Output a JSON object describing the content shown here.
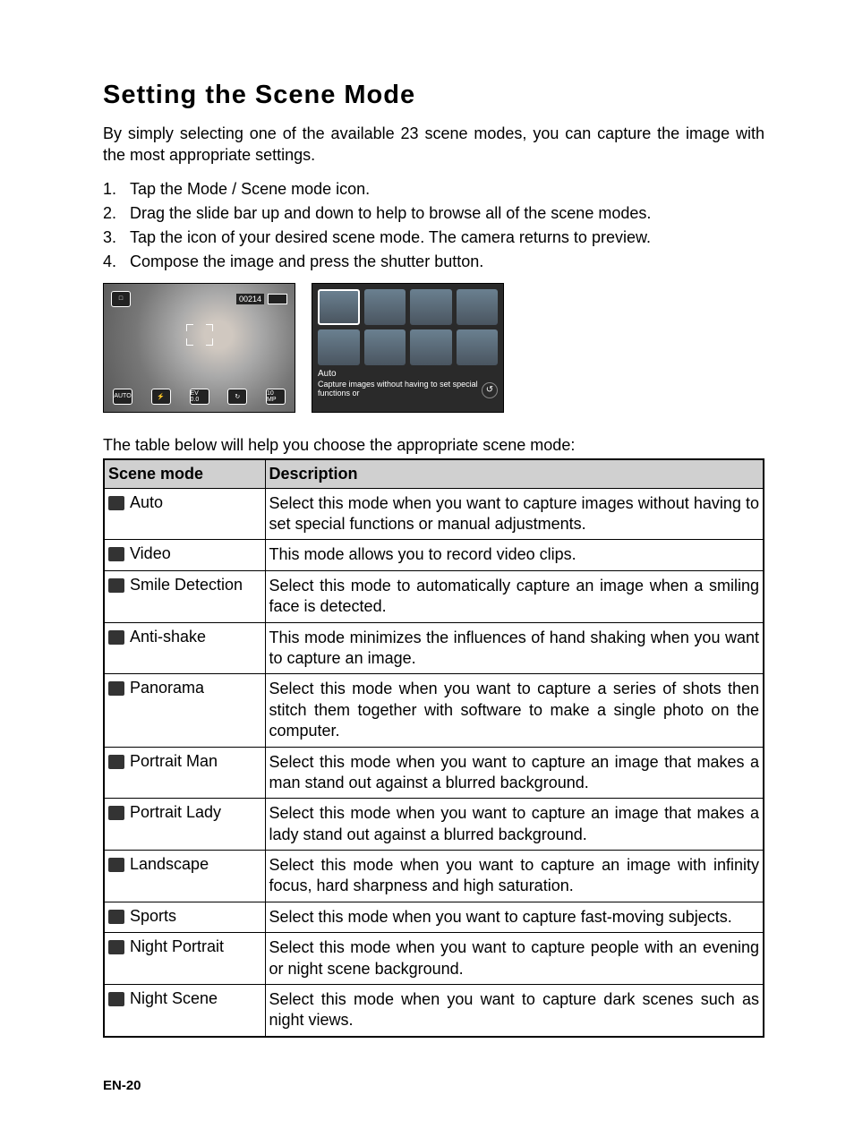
{
  "title": "Setting the Scene Mode",
  "intro": "By simply selecting one of the available 23 scene modes, you can capture the image with the most appropriate settings.",
  "steps": [
    "Tap the Mode / Scene mode icon.",
    "Drag the slide bar up and down to help to browse all of the scene modes.",
    "Tap the icon of your desired scene mode.  The camera returns to preview.",
    "Compose the image and press the shutter button."
  ],
  "preview": {
    "counter": "00214",
    "bottom_icons": [
      "AUTO",
      "⚡",
      "EV 0.0",
      "↻",
      "10 MP"
    ]
  },
  "scene_popup": {
    "title": "Auto",
    "caption": "Capture images without having to set special functions or"
  },
  "table_intro": "The table below will help you choose the appropriate scene mode:",
  "table": {
    "headers": [
      "Scene mode",
      "Description"
    ],
    "rows": [
      {
        "icon": "auto-icon",
        "mode": "Auto",
        "desc": "Select this mode when you want to capture images without having to set special functions or manual adjustments."
      },
      {
        "icon": "video-icon",
        "mode": "Video",
        "desc": "This mode allows you to record video clips."
      },
      {
        "icon": "smile-detection-icon",
        "mode": "Smile Detection",
        "desc": "Select this mode to automatically capture an image when a smiling face is detected."
      },
      {
        "icon": "anti-shake-icon",
        "mode": "Anti-shake",
        "desc": "This mode minimizes the influences of hand shaking when you want to capture an image."
      },
      {
        "icon": "panorama-icon",
        "mode": "Panorama",
        "desc": "Select this mode when you want to capture a series of shots then stitch them together with software to make a single photo on the computer."
      },
      {
        "icon": "portrait-man-icon",
        "mode": "Portrait Man",
        "desc": "Select this mode when you want to capture an image that makes a man stand out against a blurred background."
      },
      {
        "icon": "portrait-lady-icon",
        "mode": "Portrait Lady",
        "desc": "Select this mode when you want to capture an image that makes a lady stand out against a blurred background."
      },
      {
        "icon": "landscape-icon",
        "mode": "Landscape",
        "desc": "Select this mode when you want to capture an image with infinity focus, hard sharpness and high saturation."
      },
      {
        "icon": "sports-icon",
        "mode": "Sports",
        "desc": "Select this mode when you want to capture fast-moving subjects."
      },
      {
        "icon": "night-portrait-icon",
        "mode": "Night Portrait",
        "desc": "Select this mode when you want to capture people with an evening or night scene background."
      },
      {
        "icon": "night-scene-icon",
        "mode": "Night Scene",
        "desc": "Select this mode when you want to capture dark scenes such as night views."
      }
    ]
  },
  "page_num": "EN-20"
}
